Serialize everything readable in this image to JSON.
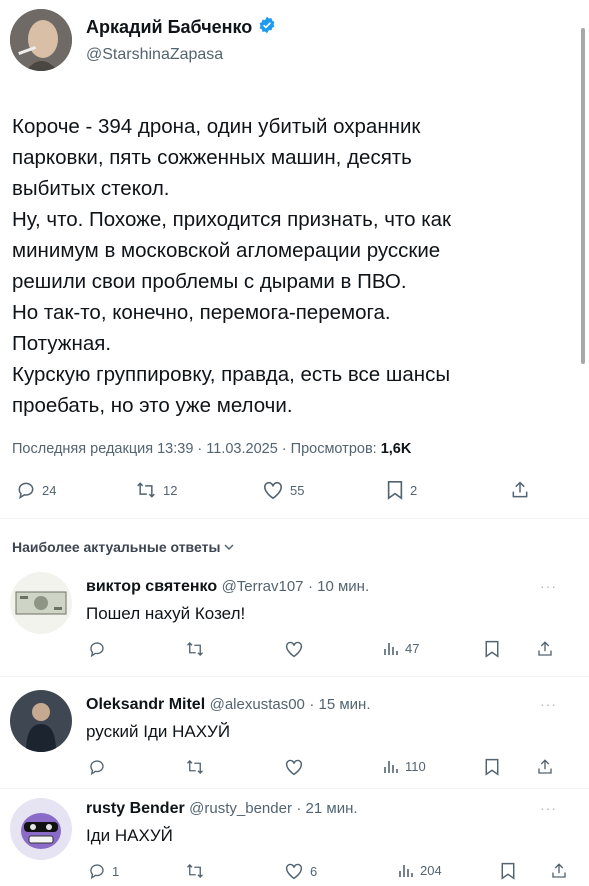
{
  "author": {
    "name": "Аркадий Бабченко",
    "handle": "@StarshinaZapasa",
    "verified_color": "#1d9bf0"
  },
  "tweet": {
    "lines": [
      "Короче - 394 дрона, один убитый охранник",
      "парковки, пять сожженных машин, десять",
      "выбитых стекол.",
      "Ну, что. Похоже, приходится признать, что как",
      "минимум в московской агломерации русские",
      "решили свои проблемы с дырами в ПВО.",
      "Но так-то, конечно, перемога-перемога.",
      "Потужная.",
      "Курскую группировку, правда, есть все шансы",
      "проебать, но это уже мелочи."
    ],
    "edited": "Последняя редакция 13:39 · 11.03.2025",
    "views_label": " · Просмотров: ",
    "views": "1,6K",
    "actions": {
      "replies": "24",
      "retweets": "12",
      "likes": "55",
      "bookmarks": "2"
    }
  },
  "replies_header": "Наиболее актуальные ответы",
  "replies": [
    {
      "name": "виктор святенко",
      "handle": "@Terrav107",
      "time": "· 10 мин.",
      "text": "Пошел нахуй Козел!",
      "retweets": "",
      "likes": "",
      "views": "47",
      "replies": ""
    },
    {
      "name": "Oleksandr Mitel",
      "handle": "@alexustas00",
      "time": "· 15 мин.",
      "text": "руский Іди НАХУЙ",
      "retweets": "",
      "likes": "",
      "views": "110",
      "replies": ""
    },
    {
      "name": "rusty Bender",
      "handle": "@rusty_bender",
      "time": "· 21 мин.",
      "text": "Іди НАХУЙ",
      "replies": "1",
      "retweets": "",
      "likes": "6",
      "views": "204"
    }
  ],
  "more": "···"
}
